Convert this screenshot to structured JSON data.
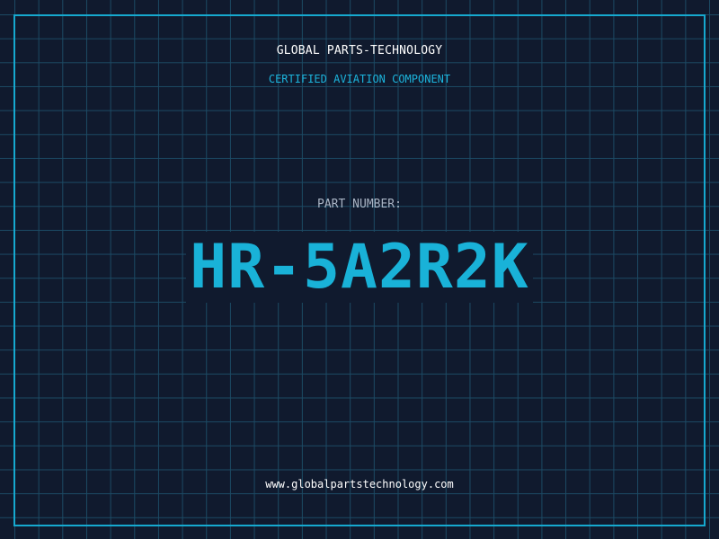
{
  "header": {
    "brand": "GLOBAL PARTS-TECHNOLOGY",
    "subtitle": "CERTIFIED AVIATION COMPONENT"
  },
  "part": {
    "label": "PART NUMBER:",
    "number": "HR-5A2R2K"
  },
  "footer": {
    "url": "www.globalpartstechnology.com"
  },
  "colors": {
    "background": "#101a2e",
    "grid": "#1c4a64",
    "frame": "#16a9cf",
    "accent": "#19b2d8",
    "label": "#a9b4c4",
    "text": "#ffffff"
  }
}
